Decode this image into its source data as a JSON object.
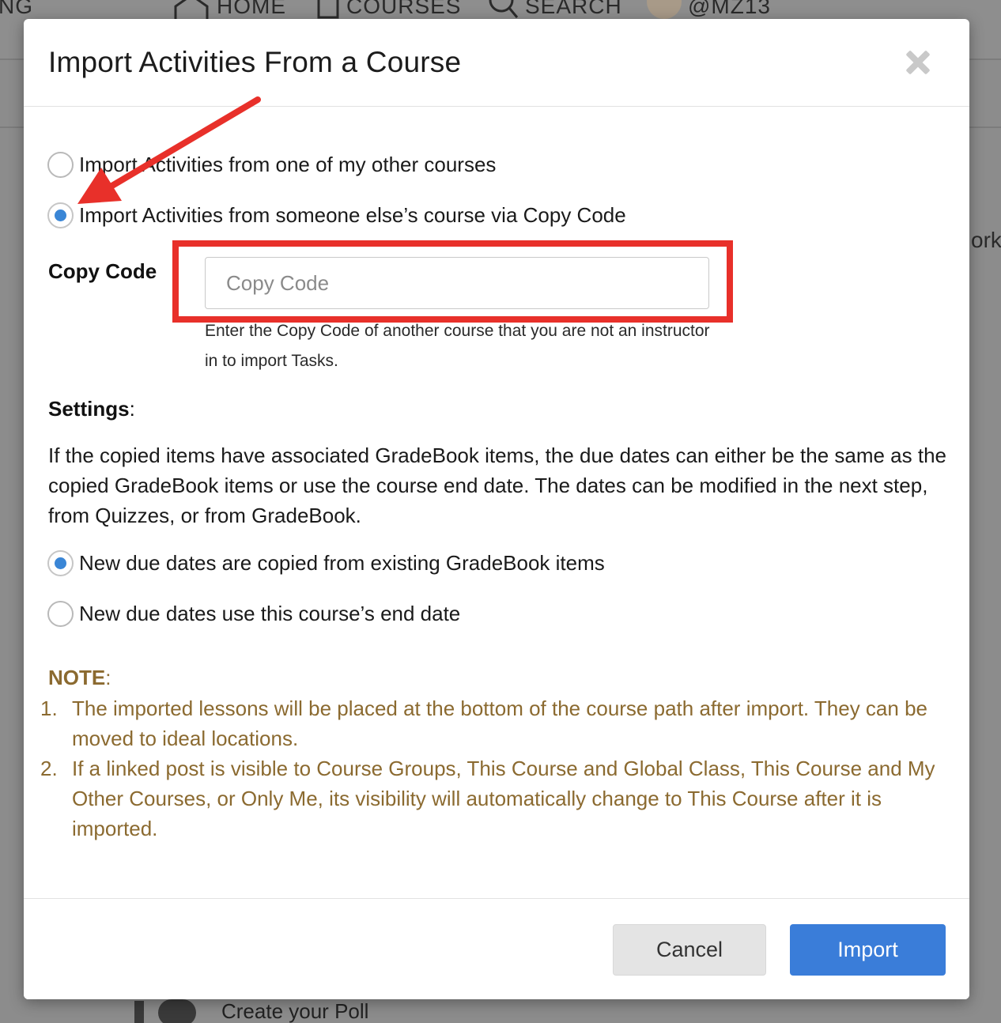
{
  "background": {
    "nav": {
      "partial_left": "NG",
      "home": "HOME",
      "courses": "COURSES",
      "search": "SEARCH",
      "user": "@MZ13"
    },
    "partial_right": "ork",
    "poll_label": "Create your Poll"
  },
  "modal": {
    "title": "Import Activities From a Course",
    "source_options": [
      {
        "label": "Import Activities from one of my other courses",
        "checked": false
      },
      {
        "label": "Import Activities from someone else’s course via Copy Code",
        "checked": true
      }
    ],
    "copy_code": {
      "label": "Copy Code",
      "placeholder": "Copy Code",
      "value": "",
      "help": "Enter the Copy Code of another course that you are not an instructor in to import Tasks."
    },
    "settings": {
      "label": "Settings",
      "suffix": ":",
      "description": "If the copied items have associated GradeBook items, the due dates can either be the same as the copied GradeBook items or use the course end date. The dates can be modified in the next step, from Quizzes, or from GradeBook.",
      "options": [
        {
          "label": "New due dates are copied from existing GradeBook items",
          "checked": true
        },
        {
          "label": "New due dates use this course’s end date",
          "checked": false
        }
      ]
    },
    "note": {
      "label": "NOTE",
      "suffix": ":",
      "items": [
        {
          "num": "1.",
          "text": "The imported lessons will be placed at the bottom of the course path after import. They can be moved to ideal locations."
        },
        {
          "num": "2.",
          "text": "If a linked post is visible to Course Groups, This Course and Global Class, This Course and My Other Courses, or Only Me, its visibility will automatically change to This Course after it is imported."
        }
      ]
    },
    "buttons": {
      "cancel": "Cancel",
      "import": "Import"
    }
  },
  "colors": {
    "accent": "#3a7dd9",
    "note_text": "#8b6a30",
    "annotation": "#e8302a",
    "radio_dot": "#3a86d6"
  }
}
